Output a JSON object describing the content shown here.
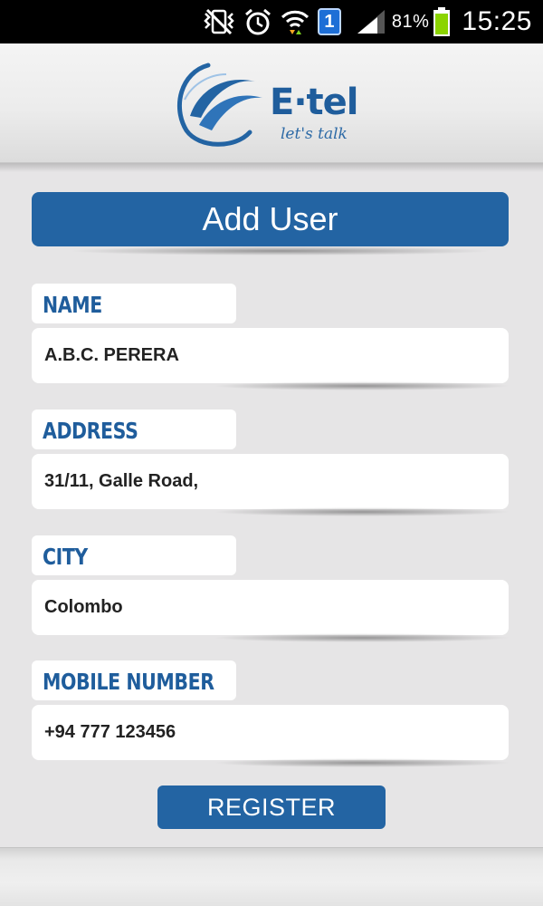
{
  "status_bar": {
    "notification_badge": "1",
    "battery_percent": "81%",
    "time": "15:25",
    "icons": [
      "mute-vibrate-icon",
      "alarm-clock-icon",
      "wifi-icon",
      "notification-badge-icon",
      "signal-icon",
      "battery-icon"
    ]
  },
  "header": {
    "brand": "E·tel",
    "tagline": "let's talk"
  },
  "page": {
    "title": "Add User"
  },
  "form": {
    "name": {
      "label": "NAME",
      "value": "A.B.C. PERERA"
    },
    "address": {
      "label": "ADDRESS",
      "value": "31/11, Galle Road,"
    },
    "city": {
      "label": "CITY",
      "value": "Colombo"
    },
    "mobile": {
      "label": "MOBILE NUMBER",
      "value": "+94 777 123456"
    }
  },
  "actions": {
    "register_label": "REGISTER"
  },
  "colors": {
    "primary": "#2364a3",
    "label_text": "#1f5d9c",
    "background": "#e6e5e6",
    "battery": "#8bd400"
  }
}
